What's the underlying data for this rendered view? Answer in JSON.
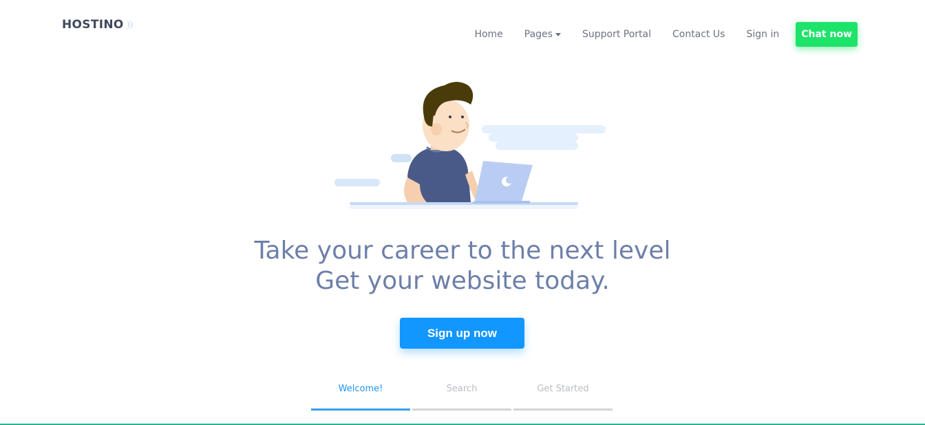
{
  "header": {
    "logo_text": "HOSTINO",
    "nav": [
      {
        "label": "Home"
      },
      {
        "label": "Pages",
        "has_dropdown": true
      },
      {
        "label": "Support Portal"
      },
      {
        "label": "Contact Us"
      },
      {
        "label": "Sign in"
      }
    ],
    "chat_button": "Chat now"
  },
  "hero": {
    "line1": "Take your career to the next level",
    "line2": "Get your website today.",
    "cta_label": "Sign up now"
  },
  "tabs": [
    {
      "label": "Welcome!",
      "active": true
    },
    {
      "label": "Search",
      "active": false
    },
    {
      "label": "Get Started",
      "active": false
    }
  ],
  "colors": {
    "accent_green": "#1ee36a",
    "accent_blue": "#1296ff",
    "hero_text": "#6d7fa8",
    "bottom_line": "#1fb98e"
  }
}
